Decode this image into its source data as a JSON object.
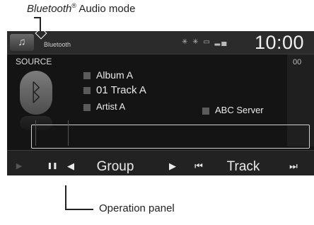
{
  "callouts": {
    "top_em": "Bluetooth",
    "top_reg": "®",
    "top_rest": " Audio mode",
    "bottom": "Operation panel"
  },
  "status": {
    "mode": "Bluetooth",
    "clock": "10:00",
    "icons": "✳ ✳ ▭ ▂▄"
  },
  "source_label": "SOURCE",
  "track_info": {
    "album": "Album A",
    "track": "01  Track A",
    "artist": "Artist A",
    "server": "ABC Server",
    "elapsed": "00"
  },
  "controls": {
    "play": "▶",
    "pause": "❚❚",
    "group_prev": "◀",
    "group_label": "Group",
    "group_next": "▶",
    "track_prev": "⏮",
    "track_label": "Track",
    "track_next": "⏭"
  },
  "icons": {
    "music": "♫",
    "bluetooth": "ᛒ"
  }
}
